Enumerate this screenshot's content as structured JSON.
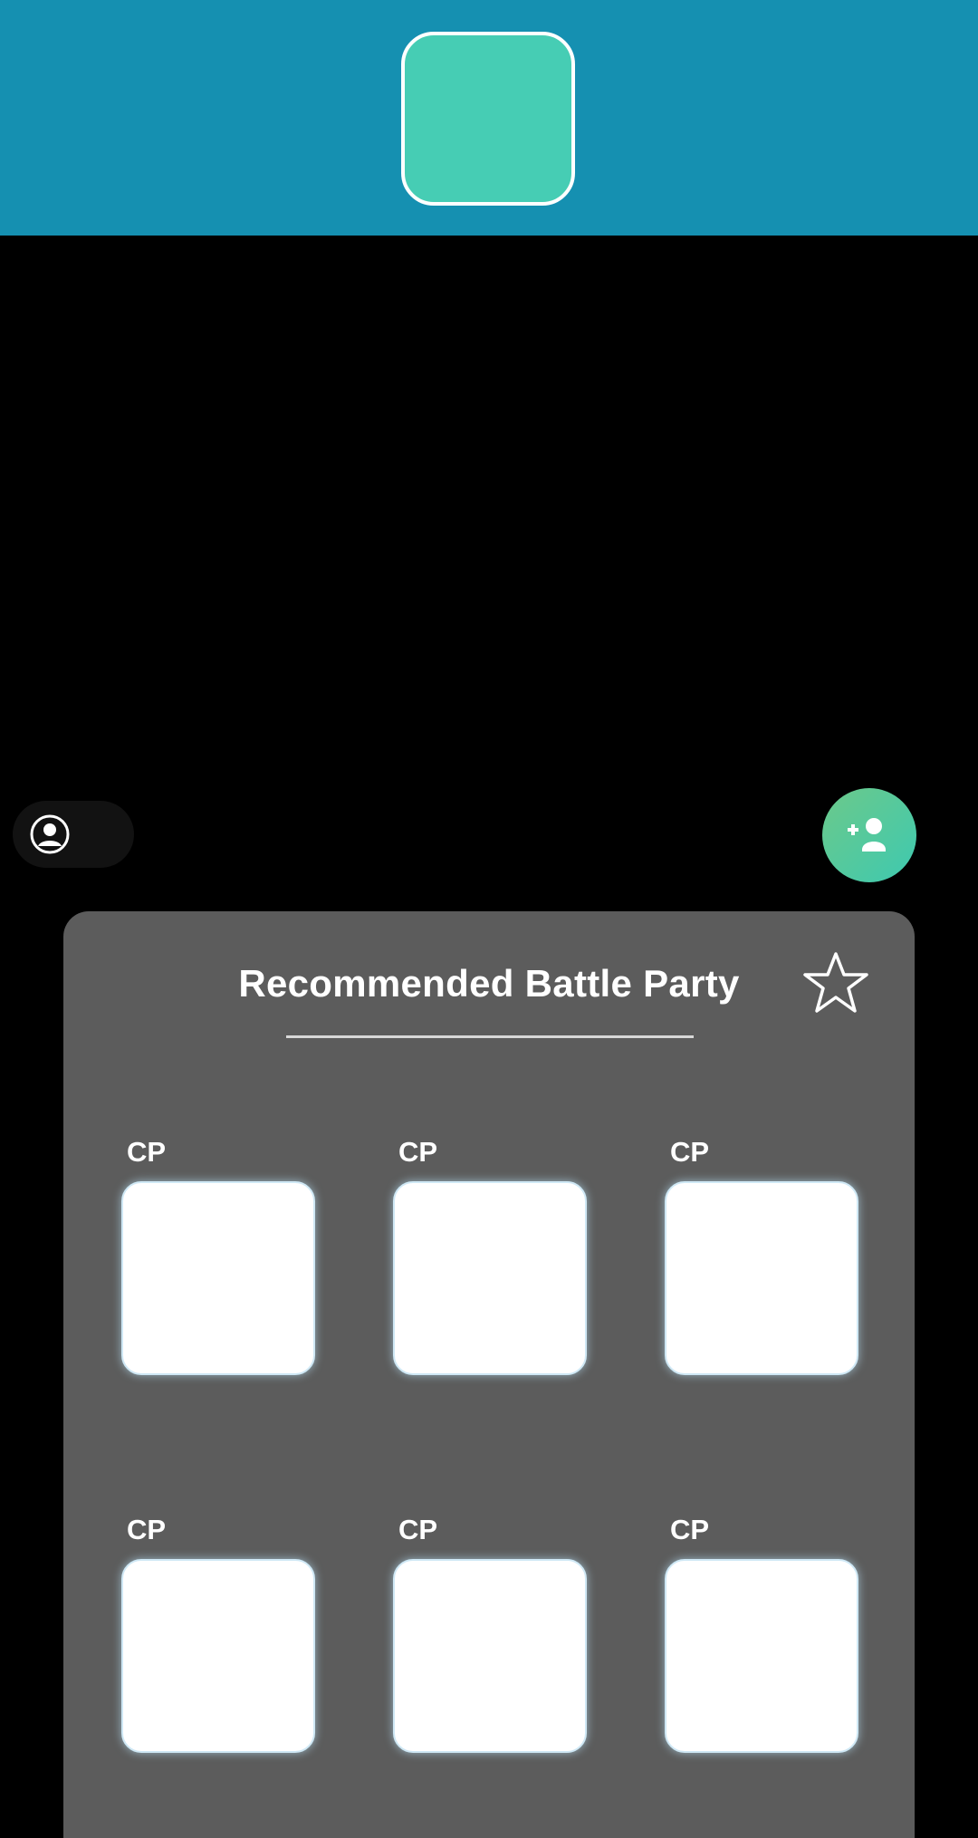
{
  "panel": {
    "title": "Recommended Battle Party",
    "slots": [
      {
        "cp_label": "CP"
      },
      {
        "cp_label": "CP"
      },
      {
        "cp_label": "CP"
      },
      {
        "cp_label": "CP"
      },
      {
        "cp_label": "CP"
      },
      {
        "cp_label": "CP"
      }
    ]
  },
  "icons": {
    "profile": "user-circle-icon",
    "add_friend": "add-friend-icon",
    "favorite": "star-outline-icon"
  },
  "colors": {
    "top_bar": "#1590b1",
    "top_tile": "#46cdb4",
    "panel": "#5c5c5c",
    "accent_green": "#3ec9b0"
  }
}
